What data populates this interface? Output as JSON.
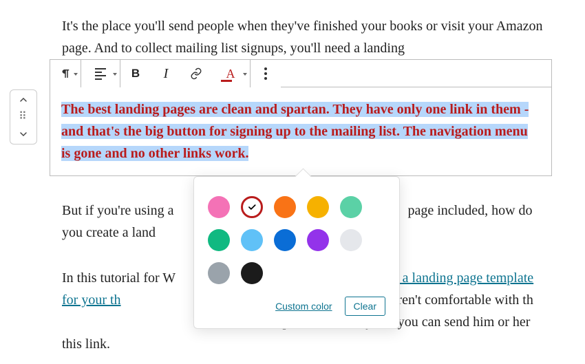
{
  "paragraphs": {
    "p1": "It's the place you'll send people when they've finished your books or visit your Amazon page. And to collect mailing list signups, you'll need a landing",
    "p2_selected": "The best landing pages are clean and spartan. They have only one link in them - and that's the big button for signing up to the mailing list. The navigation menu is gone and no other links work.",
    "p3_a": "But if you're using a",
    "p3_b": " page included, how do you create a land",
    "p4_a": "In this tutorial for W",
    "p4_link1": "e a landing page template for your th",
    "p4_b": " so if you aren't comfortable with th",
    "p4_c": "loper to do it for you - you can send him or her this link."
  },
  "toolbar": {
    "block_type": "paragraph",
    "align": "align-left",
    "bold": "B",
    "italic": "I",
    "color_letter": "A"
  },
  "color_popover": {
    "swatches": [
      {
        "name": "pink",
        "color": "#f472b6"
      },
      {
        "name": "red",
        "color": "#b91c1c",
        "selected": true
      },
      {
        "name": "orange",
        "color": "#f97316"
      },
      {
        "name": "amber",
        "color": "#f6b100"
      },
      {
        "name": "teal",
        "color": "#5bd1a6"
      },
      {
        "name": "green",
        "color": "#10b981"
      },
      {
        "name": "sky",
        "color": "#60c1f7"
      },
      {
        "name": "blue",
        "color": "#0a6dd6"
      },
      {
        "name": "purple",
        "color": "#9333ea"
      },
      {
        "name": "light-gray",
        "color": "#e5e7eb"
      },
      {
        "name": "gray",
        "color": "#9aa3ab"
      },
      {
        "name": "black",
        "color": "#1b1b1b"
      }
    ],
    "custom_label": "Custom color",
    "clear_label": "Clear"
  }
}
